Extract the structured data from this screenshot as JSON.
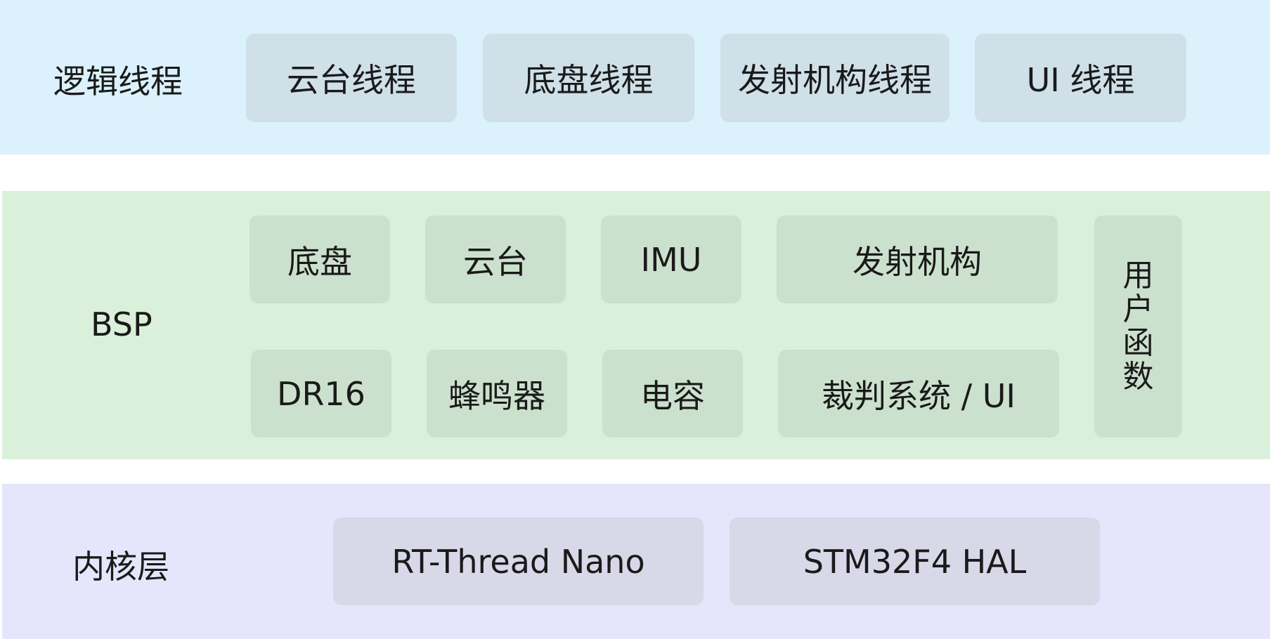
{
  "logic_layer": {
    "label": "逻辑线程",
    "boxes": [
      "云台线程",
      "底盘线程",
      "发射机构线程",
      "UI 线程"
    ]
  },
  "bsp_layer": {
    "label": "BSP",
    "row1": [
      "底盘",
      "云台",
      "IMU",
      "发射机构"
    ],
    "row2": [
      "DR16",
      "蜂鸣器",
      "电容",
      "裁判系统 / UI"
    ],
    "user_functions": [
      "用",
      "户",
      "函",
      "数"
    ]
  },
  "kernel_layer": {
    "label": "内核层",
    "boxes": [
      "RT-Thread Nano",
      "STM32F4 HAL"
    ]
  }
}
